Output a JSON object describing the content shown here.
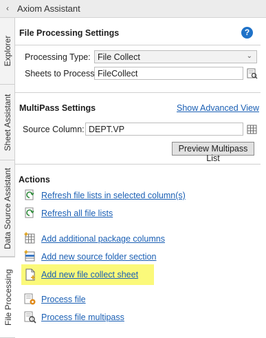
{
  "titlebar": {
    "collapse_glyph": "‹",
    "title": "Axiom Assistant"
  },
  "tabs": [
    {
      "label": "Explorer",
      "active": false
    },
    {
      "label": "Sheet Assistant",
      "active": false
    },
    {
      "label": "Data Source Assistant",
      "active": false
    },
    {
      "label": "File Processing",
      "active": true
    }
  ],
  "file_processing": {
    "title": "File Processing Settings",
    "help_glyph": "?",
    "processing_type_label": "Processing Type:",
    "processing_type_value": "File Collect",
    "sheets_label": "Sheets to Process:",
    "sheets_value": "FileCollect"
  },
  "multipass": {
    "title": "MultiPass Settings",
    "show_advanced": "Show Advanced View",
    "source_column_label": "Source Column:",
    "source_column_value": "DEPT.VP",
    "preview_button": "Preview Multipass List"
  },
  "actions": {
    "title": "Actions",
    "items": [
      {
        "label": "Refresh file lists in selected column(s)",
        "icon": "refresh-icon"
      },
      {
        "label": "Refresh all file lists",
        "icon": "refresh-icon"
      },
      {
        "label": "Add additional package columns",
        "icon": "add-columns-icon"
      },
      {
        "label": "Add new source folder section",
        "icon": "add-section-icon"
      },
      {
        "label": "Add new file collect sheet",
        "icon": "new-sheet-icon"
      },
      {
        "label": "Process file",
        "icon": "process-icon"
      },
      {
        "label": "Process file multipass",
        "icon": "process-multipass-icon"
      }
    ]
  },
  "colors": {
    "link": "#1a5fb4",
    "highlight": "#fbf97a",
    "help": "#1f72c8"
  }
}
